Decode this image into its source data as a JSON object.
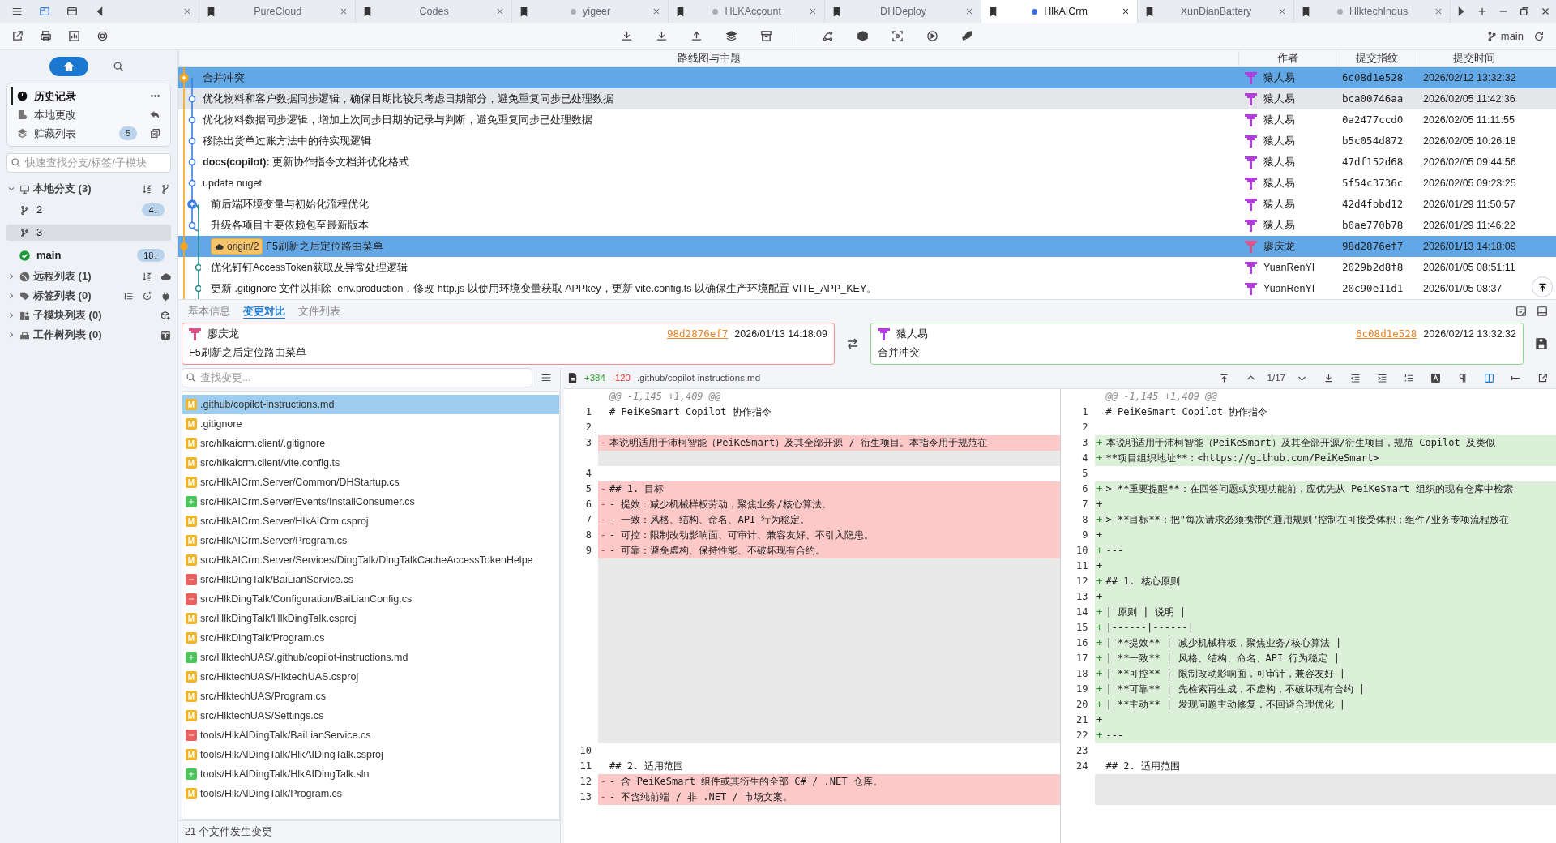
{
  "tabs": [
    {
      "selected": false,
      "dot": false
    },
    {
      "label": "PureCloud",
      "selected": false,
      "dot": false
    },
    {
      "label": "Codes",
      "selected": false,
      "dot": false
    },
    {
      "label": "yigeer",
      "selected": false,
      "dot": true
    },
    {
      "label": "HLKAccount",
      "selected": false,
      "dot": true
    },
    {
      "label": "DHDeploy",
      "selected": false,
      "dot": false
    },
    {
      "label": "HlkAICrm",
      "selected": true,
      "dot": true
    },
    {
      "label": "XunDianBattery",
      "selected": false,
      "dot": false
    },
    {
      "label": "HlktechIndus",
      "selected": false,
      "dot": true
    }
  ],
  "toolbar": {
    "branch": "main"
  },
  "sidebar": {
    "nav": [
      {
        "label": "历史记录",
        "kind": "history",
        "selected": true
      },
      {
        "label": "本地更改",
        "kind": "changes",
        "selected": false
      },
      {
        "label": "贮藏列表",
        "kind": "stashes",
        "selected": false,
        "count": "5"
      }
    ],
    "search": {
      "placeholder": "快速查找分支/标签/子模块"
    },
    "groups": [
      {
        "label": "本地分支 (3)",
        "kind": "local",
        "expanded": true,
        "children": [
          {
            "label": "2",
            "selected": false,
            "current": false,
            "badge": "4↓"
          },
          {
            "label": "3",
            "selected": true,
            "current": false
          },
          {
            "label": "main",
            "selected": false,
            "current": true,
            "badge": "18↓"
          }
        ]
      },
      {
        "label": "远程列表 (1)",
        "kind": "remote",
        "expanded": false
      },
      {
        "label": "标签列表 (0)",
        "kind": "tags",
        "expanded": false
      },
      {
        "label": "子模块列表 (0)",
        "kind": "submodules",
        "expanded": false
      },
      {
        "label": "工作树列表 (0)",
        "kind": "worktrees",
        "expanded": false
      }
    ]
  },
  "commits": {
    "columns": [
      "路线图与主题",
      "作者",
      "提交指纹",
      "提交时间"
    ],
    "rows": [
      {
        "subject": "合并冲突",
        "author": "猿人易",
        "color": "#b23ee0",
        "sha": "6c08d1e528",
        "time": "2026/02/12 13:32:32",
        "kind": "merge",
        "selected": true,
        "hovered": false
      },
      {
        "subject": "优化物料和客户数据同步逻辑，确保日期比较只考虑日期部分，避免重复同步已处理数据",
        "author": "猿人易",
        "color": "#b23ee0",
        "sha": "bca00746aa",
        "time": "2026/02/05 11:42:36",
        "kind": "main",
        "selected": false,
        "hovered": true
      },
      {
        "subject": "优化物料数据同步逻辑，增加上次同步日期的记录与判断，避免重复同步已处理数据",
        "author": "猿人易",
        "color": "#b23ee0",
        "sha": "0a2477ccd0",
        "time": "2026/02/05 11:11:55",
        "kind": "main",
        "selected": false,
        "hovered": false
      },
      {
        "subject": "移除出货单过账方法中的待实现逻辑",
        "author": "猿人易",
        "color": "#b23ee0",
        "sha": "b5c054d872",
        "time": "2026/02/05 10:26:18",
        "kind": "main",
        "selected": false,
        "hovered": false
      },
      {
        "subject": "**docs(copilot):** 更新协作指令文档并优化格式",
        "author": "猿人易",
        "color": "#b23ee0",
        "sha": "47df152d68",
        "time": "2026/02/05 09:44:56",
        "kind": "main",
        "selected": false,
        "hovered": false
      },
      {
        "subject": "update nuget",
        "author": "猿人易",
        "color": "#b23ee0",
        "sha": "5f54c3736c",
        "time": "2026/02/05 09:23:25",
        "kind": "main",
        "selected": false,
        "hovered": false
      },
      {
        "subject": "前后端环境变量与初始化流程优化",
        "author": "猿人易",
        "color": "#b23ee0",
        "sha": "42d4fbbd12",
        "time": "2026/01/29 11:50:57",
        "kind": "fork",
        "selected": false,
        "hovered": false
      },
      {
        "subject": "升级各项目主要依赖包至最新版本",
        "author": "猿人易",
        "color": "#b23ee0",
        "sha": "b0ae770b78",
        "time": "2026/01/29 11:46:22",
        "kind": "side",
        "selected": false,
        "hovered": false
      },
      {
        "subject": "F5刷新之后定位路由菜单",
        "tags": [
          "origin/2"
        ],
        "author": "廖庆龙",
        "color": "#e0508a",
        "sha": "98d2876ef7",
        "time": "2026/01/13 14:18:09",
        "kind": "tip",
        "selected": true,
        "hovered": false
      },
      {
        "subject": "优化钉钉AccessToken获取及异常处理逻辑",
        "author": "YuanRenYI",
        "color": "#b23ee0",
        "sha": "2029b2d8f8",
        "time": "2026/01/05 08:51:11",
        "kind": "remote",
        "selected": false,
        "hovered": false
      },
      {
        "subject": "更新 .gitignore 文件以排除 .env.production，修改 http.js 以使用环境变量获取 APPkey，更新 vite.config.ts 以确保生产环境配置 VITE_APP_KEY。",
        "author": "YuanRenYI",
        "color": "#b23ee0",
        "sha": "20c90e11d1",
        "time": "2026/01/05 08:37",
        "kind": "remote",
        "selected": false,
        "hovered": false
      }
    ]
  },
  "detail": {
    "tabs": [
      {
        "label": "基本信息",
        "selected": false
      },
      {
        "label": "变更对比",
        "selected": true
      },
      {
        "label": "文件列表",
        "selected": false
      }
    ],
    "base": {
      "author": "廖庆龙",
      "color": "#e0508a",
      "sha": "98d2876ef7",
      "time": "2026/01/13 14:18:09",
      "message": "F5刷新之后定位路由菜单"
    },
    "target": {
      "author": "猿人易",
      "color": "#b23ee0",
      "sha": "6c08d1e528",
      "time": "2026/02/12 13:32:32",
      "message": "合并冲突"
    }
  },
  "files": {
    "placeholder": "查找变更...",
    "summary": "21 个文件发生变更",
    "items": [
      {
        "path": ".github/copilot-instructions.md",
        "kind": "modified",
        "badge": "M",
        "selected": true
      },
      {
        "path": ".gitignore",
        "kind": "modified",
        "badge": "M",
        "selected": false
      },
      {
        "path": "src/hlkaicrm.client/.gitignore",
        "kind": "modified",
        "badge": "M",
        "selected": false
      },
      {
        "path": "src/hlkaicrm.client/vite.config.ts",
        "kind": "modified",
        "badge": "M",
        "selected": false
      },
      {
        "path": "src/HlkAICrm.Server/Common/DHStartup.cs",
        "kind": "modified",
        "badge": "M",
        "selected": false
      },
      {
        "path": "src/HlkAICrm.Server/Events/InstallConsumer.cs",
        "kind": "added",
        "selected": false
      },
      {
        "path": "src/HlkAICrm.Server/HlkAICrm.csproj",
        "kind": "modified",
        "badge": "M",
        "selected": false
      },
      {
        "path": "src/HlkAICrm.Server/Program.cs",
        "kind": "modified",
        "badge": "M",
        "selected": false
      },
      {
        "path": "src/HlkAICrm.Server/Services/DingTalk/DingTalkCacheAccessTokenHelpe",
        "kind": "modified",
        "badge": "M",
        "selected": false
      },
      {
        "path": "src/HlkDingTalk/BaiLianService.cs",
        "kind": "deleted",
        "selected": false
      },
      {
        "path": "src/HlkDingTalk/Configuration/BaiLianConfig.cs",
        "kind": "deleted",
        "selected": false
      },
      {
        "path": "src/HlkDingTalk/HlkDingTalk.csproj",
        "kind": "modified",
        "badge": "M",
        "selected": false
      },
      {
        "path": "src/HlkDingTalk/Program.cs",
        "kind": "modified",
        "badge": "M",
        "selected": false
      },
      {
        "path": "src/HlktechUAS/.github/copilot-instructions.md",
        "kind": "added",
        "selected": false
      },
      {
        "path": "src/HlktechUAS/HlktechUAS.csproj",
        "kind": "modified",
        "badge": "M",
        "selected": false
      },
      {
        "path": "src/HlktechUAS/Program.cs",
        "kind": "modified",
        "badge": "M",
        "selected": false
      },
      {
        "path": "src/HlktechUAS/Settings.cs",
        "kind": "modified",
        "badge": "M",
        "selected": false
      },
      {
        "path": "tools/HlkAIDingTalk/BaiLianService.cs",
        "kind": "deleted",
        "selected": false
      },
      {
        "path": "tools/HlkAIDingTalk/HlkAIDingTalk.csproj",
        "kind": "modified",
        "badge": "M",
        "selected": false
      },
      {
        "path": "tools/HlkAIDingTalk/HlkAIDingTalk.sln",
        "kind": "added",
        "selected": false
      },
      {
        "path": "tools/HlkAIDingTalk/Program.cs",
        "kind": "modified",
        "badge": "M",
        "selected": false
      }
    ]
  },
  "diff": {
    "added": "+384",
    "removed": "-120",
    "path": ".github/copilot-instructions.md",
    "position": "1/17",
    "hunk_left": "@@ -1,145 +1,409 @@",
    "hunk_right": "@@ -1,145 +1,409 @@",
    "rows": [
      {
        "left": {
          "kind": "context",
          "number": "1",
          "text": "# PeiKeSmart Copilot 协作指令"
        },
        "right": {
          "kind": "context",
          "number": "1",
          "text": "# PeiKeSmart Copilot 协作指令"
        }
      },
      {
        "left": {
          "kind": "context",
          "number": "2"
        },
        "right": {
          "kind": "context",
          "number": "2"
        }
      },
      {
        "left": {
          "kind": "deleted",
          "number": "3",
          "sign": "-",
          "text": "本说明适用于沛柯智能（PeiKeSmart）及其全部开源 / 衍生项目。本指令用于规范在"
        },
        "right": {
          "kind": "added",
          "number": "3",
          "sign": "+",
          "text": "本说明适用于沛柯智能（PeiKeSmart）及其全部开源/衍生项目，规范 Copilot 及类似"
        }
      },
      {
        "left": {
          "kind": "filler"
        },
        "right": {
          "kind": "added",
          "number": "4",
          "sign": "+",
          "text": "**项目组织地址**：<https://github.com/PeiKeSmart>"
        }
      },
      {
        "left": {
          "kind": "context",
          "number": "4"
        },
        "right": {
          "kind": "context",
          "number": "5"
        }
      },
      {
        "left": {
          "kind": "deleted",
          "number": "5",
          "sign": "-",
          "text": "## 1. 目标"
        },
        "right": {
          "kind": "added",
          "number": "6",
          "sign": "+",
          "text": "> **重要提醒**：在回答问题或实现功能前，应优先从 PeiKeSmart 组织的现有仓库中检索"
        }
      },
      {
        "left": {
          "kind": "deleted",
          "number": "6",
          "sign": "-",
          "text": "- 提效：减少机械样板劳动，聚焦业务/核心算法。"
        },
        "right": {
          "kind": "added",
          "number": "7",
          "sign": "+"
        }
      },
      {
        "left": {
          "kind": "deleted",
          "number": "7",
          "sign": "-",
          "text": "- 一致：风格、结构、命名、API 行为稳定。"
        },
        "right": {
          "kind": "added",
          "number": "8",
          "sign": "+",
          "text": "> **目标**：把\"每次请求必须携带的通用规则\"控制在可接受体积；组件/业务专项流程放在"
        }
      },
      {
        "left": {
          "kind": "deleted",
          "number": "8",
          "sign": "-",
          "text": "- 可控：限制改动影响面、可审计、兼容友好、不引入隐患。"
        },
        "right": {
          "kind": "added",
          "number": "9",
          "sign": "+"
        }
      },
      {
        "left": {
          "kind": "deleted",
          "number": "9",
          "sign": "-",
          "text": "- 可靠：避免虚构、保持性能、不破坏现有合约。"
        },
        "right": {
          "kind": "added",
          "number": "10",
          "sign": "+",
          "text": "---"
        }
      },
      {
        "left": {
          "kind": "filler"
        },
        "right": {
          "kind": "added",
          "number": "11",
          "sign": "+"
        }
      },
      {
        "left": {
          "kind": "filler"
        },
        "right": {
          "kind": "added",
          "number": "12",
          "sign": "+",
          "text": "## 1. 核心原则"
        }
      },
      {
        "left": {
          "kind": "filler"
        },
        "right": {
          "kind": "added",
          "number": "13",
          "sign": "+"
        }
      },
      {
        "left": {
          "kind": "filler"
        },
        "right": {
          "kind": "added",
          "number": "14",
          "sign": "+",
          "text": "| 原则 | 说明 |"
        }
      },
      {
        "left": {
          "kind": "filler"
        },
        "right": {
          "kind": "added",
          "number": "15",
          "sign": "+",
          "text": "|------|------|"
        }
      },
      {
        "left": {
          "kind": "filler"
        },
        "right": {
          "kind": "added",
          "number": "16",
          "sign": "+",
          "text": "| **提效** | 减少机械样板，聚焦业务/核心算法 |"
        }
      },
      {
        "left": {
          "kind": "filler"
        },
        "right": {
          "kind": "added",
          "number": "17",
          "sign": "+",
          "text": "| **一致** | 风格、结构、命名、API 行为稳定 |"
        }
      },
      {
        "left": {
          "kind": "filler"
        },
        "right": {
          "kind": "added",
          "number": "18",
          "sign": "+",
          "text": "| **可控** | 限制改动影响面，可审计，兼容友好 |"
        }
      },
      {
        "left": {
          "kind": "filler"
        },
        "right": {
          "kind": "added",
          "number": "19",
          "sign": "+",
          "text": "| **可靠** | 先检索再生成，不虚构，不破坏现有合约 |"
        }
      },
      {
        "left": {
          "kind": "filler"
        },
        "right": {
          "kind": "added",
          "number": "20",
          "sign": "+",
          "text": "| **主动** | 发现问题主动修复，不回避合理优化 |"
        }
      },
      {
        "left": {
          "kind": "filler"
        },
        "right": {
          "kind": "added",
          "number": "21",
          "sign": "+"
        }
      },
      {
        "left": {
          "kind": "filler"
        },
        "right": {
          "kind": "added",
          "number": "22",
          "sign": "+",
          "text": "---"
        }
      },
      {
        "left": {
          "kind": "context",
          "number": "10"
        },
        "right": {
          "kind": "context",
          "number": "23"
        }
      },
      {
        "left": {
          "kind": "context",
          "number": "11",
          "text": "## 2. 适用范围"
        },
        "right": {
          "kind": "context",
          "number": "24",
          "text": "## 2. 适用范围"
        }
      },
      {
        "left": {
          "kind": "deleted",
          "number": "12",
          "sign": "-",
          "text": "- 含 PeiKeSmart 组件或其衍生的全部 C# / .NET 仓库。"
        },
        "right": {
          "kind": "filler"
        }
      },
      {
        "left": {
          "kind": "deleted",
          "number": "13",
          "sign": "-",
          "text": "- 不含纯前端 / 非 .NET / 市场文案。"
        },
        "right": {
          "kind": "filler"
        }
      }
    ]
  }
}
